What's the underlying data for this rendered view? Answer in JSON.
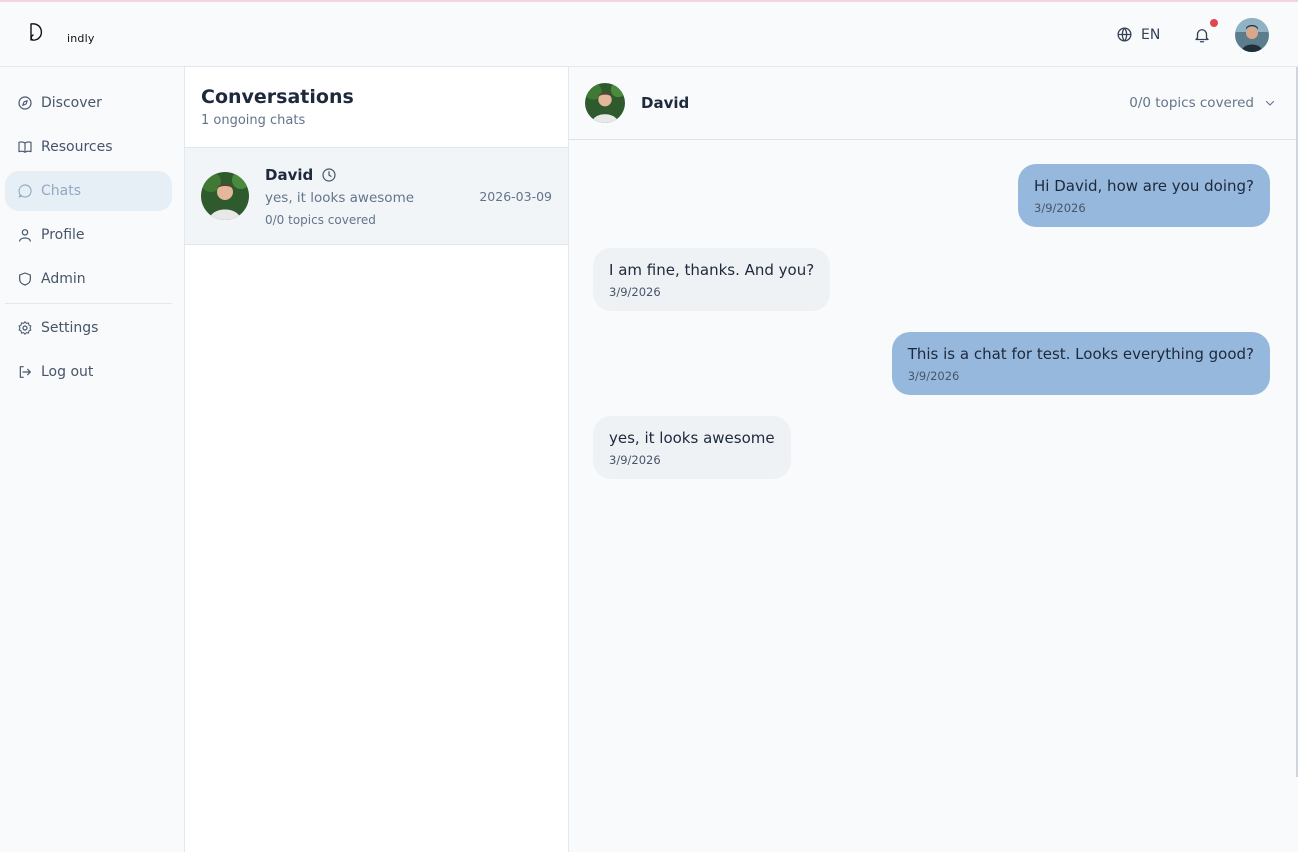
{
  "app": {
    "logo_text": "indly",
    "language": "EN",
    "notification_dot_color": "#e0474d"
  },
  "sidebar": {
    "items": [
      {
        "label": "Discover",
        "icon": "compass-icon"
      },
      {
        "label": "Resources",
        "icon": "book-icon"
      },
      {
        "label": "Chats",
        "icon": "chat-bubble-icon",
        "active": true
      },
      {
        "label": "Profile",
        "icon": "user-icon"
      },
      {
        "label": "Admin",
        "icon": "shield-icon"
      },
      {
        "label": "Settings",
        "icon": "gear-icon"
      },
      {
        "label": "Log out",
        "icon": "logout-icon"
      }
    ]
  },
  "conversations": {
    "title": "Conversations",
    "subtitle": "1 ongoing chats",
    "items": [
      {
        "name": "David",
        "last_message": "yes, it looks awesome",
        "topics": "0/0 topics covered",
        "date": "2026-03-09"
      }
    ]
  },
  "chat": {
    "name": "David",
    "topics": "0/0 topics covered",
    "messages": [
      {
        "direction": "out",
        "text": "Hi David, how are you doing?",
        "time": "3/9/2026"
      },
      {
        "direction": "in",
        "text": "I am fine, thanks. And you?",
        "time": "3/9/2026"
      },
      {
        "direction": "out",
        "text": "This is a chat for test. Looks everything good?",
        "time": "3/9/2026"
      },
      {
        "direction": "in",
        "text": "yes, it looks awesome",
        "time": "3/9/2026"
      }
    ]
  },
  "colors": {
    "outgoing_bubble": "#97b8dd",
    "incoming_bubble": "#eef2f5",
    "active_nav_bg": "#e6eef6"
  }
}
